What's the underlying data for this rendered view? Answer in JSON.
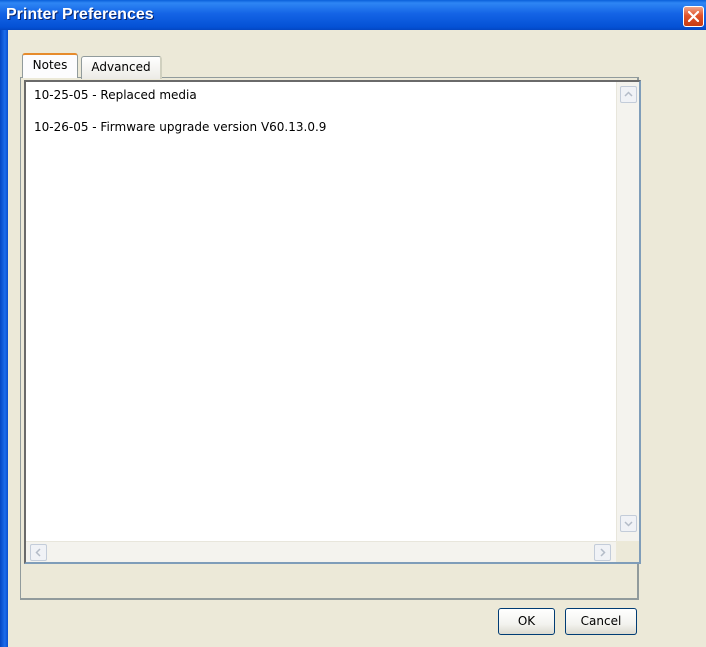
{
  "window": {
    "title": "Printer Preferences"
  },
  "tabs": [
    {
      "label": "Notes",
      "active": true
    },
    {
      "label": "Advanced",
      "active": false
    }
  ],
  "notes": {
    "lines": [
      "10-25-05 - Replaced media",
      "10-26-05 - Firmware upgrade version V60.13.0.9"
    ]
  },
  "buttons": {
    "ok_label": "OK",
    "cancel_label": "Cancel"
  },
  "icons": {
    "close": "close-icon",
    "scroll_up": "chevron-up-icon",
    "scroll_down": "chevron-down-icon",
    "scroll_left": "chevron-left-icon",
    "scroll_right": "chevron-right-icon"
  },
  "colors": {
    "titlebar": "#0A5FDA",
    "close_button": "#E0532B",
    "active_tab_accent": "#E68B2C",
    "dialog_background": "#ECE9D8"
  }
}
